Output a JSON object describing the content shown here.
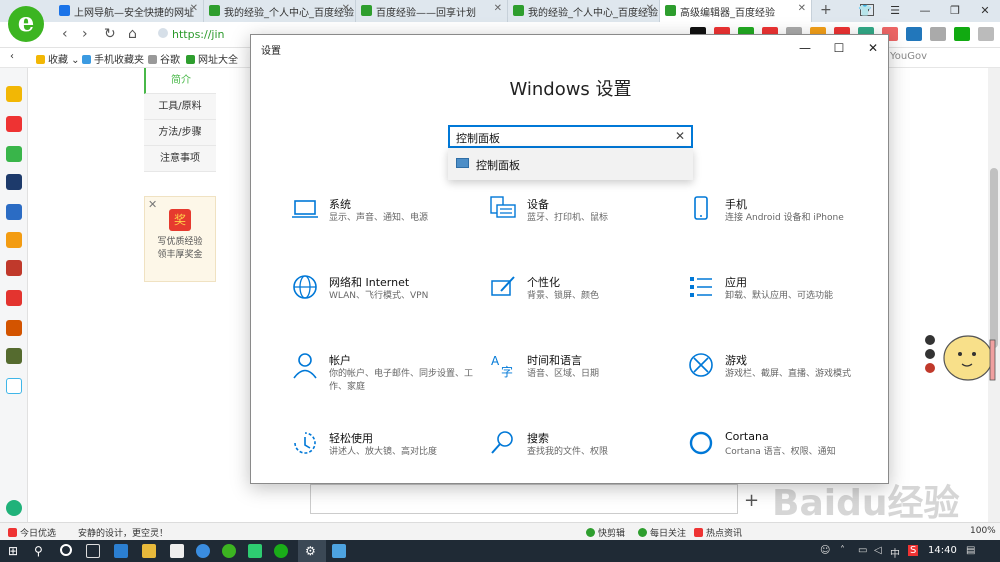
{
  "browser": {
    "tabs": [
      {
        "label": "上网导航—安全快捷的网址",
        "color": "#1a73e8"
      },
      {
        "label": "我的经验_个人中心_百度经验",
        "color": "#2e9e2e"
      },
      {
        "label": "百度经验——回享计划",
        "color": "#2e9e2e"
      },
      {
        "label": "我的经验_个人中心_百度经验",
        "color": "#2e9e2e"
      },
      {
        "label": "高级编辑器_百度经验",
        "color": "#2e9e2e"
      }
    ],
    "tab_count": "5",
    "address": "https://jin",
    "logo_letter": "e"
  },
  "bookmarks": [
    {
      "label": "收藏",
      "color": "#f2b705"
    },
    {
      "label": "手机收藏夹",
      "color": "#3b9ae1"
    },
    {
      "label": "谷歌",
      "color": "#999999"
    },
    {
      "label": "网址大全",
      "color": "#2e9e2e"
    }
  ],
  "bookmark_right": "YouGov",
  "page": {
    "sidenav": [
      "简介",
      "工具/原料",
      "方法/步骤",
      "注意事项"
    ],
    "ad_badge": "奖",
    "ad_text": [
      "写优质经验",
      "领丰厚奖金"
    ],
    "watermark": "Baidu经验"
  },
  "settings": {
    "title": "设置",
    "heading": "Windows 设置",
    "search_value": "控制面板",
    "suggestion": "控制面板",
    "accent": "#0078d7",
    "categories": [
      {
        "icon": "laptop-icon",
        "title": "系统",
        "desc": "显示、声音、通知、电源"
      },
      {
        "icon": "keyboard-icon",
        "title": "设备",
        "desc": "蓝牙、打印机、鼠标"
      },
      {
        "icon": "phone-icon",
        "title": "手机",
        "desc": "连接 Android 设备和 iPhone"
      },
      {
        "icon": "globe-icon",
        "title": "网络和 Internet",
        "desc": "WLAN、飞行模式、VPN"
      },
      {
        "icon": "brush-icon",
        "title": "个性化",
        "desc": "背景、锁屏、颜色"
      },
      {
        "icon": "apps-icon",
        "title": "应用",
        "desc": "卸载、默认应用、可选功能"
      },
      {
        "icon": "person-icon",
        "title": "帐户",
        "desc": "你的帐户、电子邮件、同步设置、工作、家庭"
      },
      {
        "icon": "language-icon",
        "title": "时间和语言",
        "desc": "语音、区域、日期"
      },
      {
        "icon": "xbox-icon",
        "title": "游戏",
        "desc": "游戏栏、截屏、直播、游戏模式"
      },
      {
        "icon": "accessibility-icon",
        "title": "轻松使用",
        "desc": "讲述人、放大镜、高对比度"
      },
      {
        "icon": "search-icon",
        "title": "搜索",
        "desc": "查找我的文件、权限"
      },
      {
        "icon": "cortana-icon",
        "title": "Cortana",
        "desc": "Cortana 语言、权限、通知"
      }
    ]
  },
  "statusbar": {
    "left1": "今日优选",
    "left2": "安静的设计，更空灵！",
    "right1": "快剪辑",
    "right2": "每日关注",
    "right3": "热点资讯",
    "zoom": "100%"
  },
  "taskbar": {
    "time": "14:40",
    "ime": "中"
  }
}
